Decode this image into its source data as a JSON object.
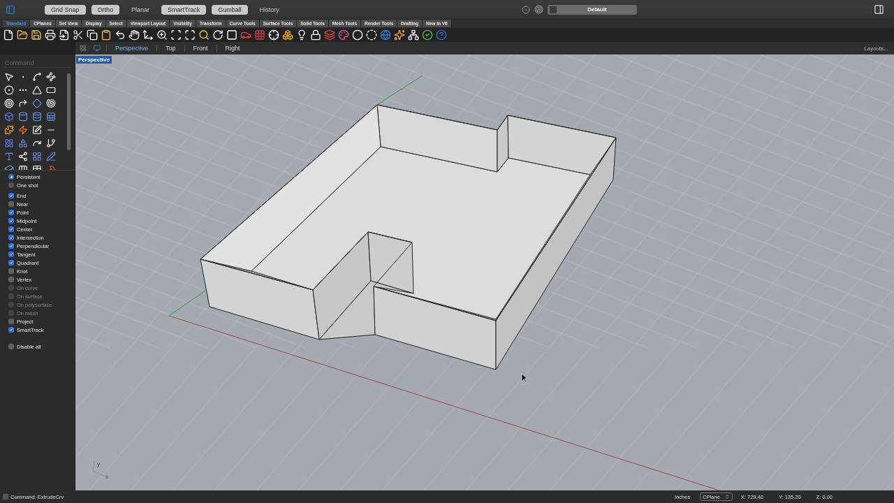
{
  "top_buttons": [
    {
      "label": "Grid Snap",
      "on": true
    },
    {
      "label": "Ortho",
      "on": true
    },
    {
      "label": "Planar",
      "on": false
    },
    {
      "label": "SmartTrack",
      "on": true
    },
    {
      "label": "Gumball",
      "on": true
    },
    {
      "label": "History",
      "on": false
    }
  ],
  "layer": {
    "name": "Default"
  },
  "toolbar_tabs": [
    {
      "label": "Standard",
      "selected": true
    },
    {
      "label": "CPlanes",
      "selected": false
    },
    {
      "label": "Set View",
      "selected": false
    },
    {
      "label": "Display",
      "selected": false
    },
    {
      "label": "Select",
      "selected": false
    },
    {
      "label": "Viewport Layout",
      "selected": false
    },
    {
      "label": "Visibility",
      "selected": false
    },
    {
      "label": "Transform",
      "selected": false
    },
    {
      "label": "Curve Tools",
      "selected": false
    },
    {
      "label": "Surface Tools",
      "selected": false
    },
    {
      "label": "Solid Tools",
      "selected": false
    },
    {
      "label": "Mesh Tools",
      "selected": false
    },
    {
      "label": "Render Tools",
      "selected": false
    },
    {
      "label": "Drafting",
      "selected": false
    },
    {
      "label": "New in V6",
      "selected": false
    }
  ],
  "command": {
    "placeholder": "Command"
  },
  "viewport_tabs": [
    {
      "label": "Perspective",
      "selected": true
    },
    {
      "label": "Top",
      "selected": false
    },
    {
      "label": "Front",
      "selected": false
    },
    {
      "label": "Right",
      "selected": false
    }
  ],
  "layouts": "Layouts...",
  "viewport": {
    "title": "Perspective",
    "gizmo_y": "y",
    "gizmo_x": "x"
  },
  "osnap_modes": [
    {
      "label": "Persistent",
      "selected": true
    },
    {
      "label": "One shot",
      "selected": false
    }
  ],
  "osnaps": [
    {
      "label": "End",
      "checked": true,
      "disabled": false
    },
    {
      "label": "Near",
      "checked": false,
      "disabled": false
    },
    {
      "label": "Point",
      "checked": true,
      "disabled": false
    },
    {
      "label": "Midpoint",
      "checked": true,
      "disabled": false
    },
    {
      "label": "Center",
      "checked": true,
      "disabled": false
    },
    {
      "label": "Intersection",
      "checked": true,
      "disabled": false
    },
    {
      "label": "Perpendicular",
      "checked": true,
      "disabled": false
    },
    {
      "label": "Tangent",
      "checked": true,
      "disabled": false
    },
    {
      "label": "Quadrant",
      "checked": true,
      "disabled": false
    },
    {
      "label": "Knot",
      "checked": false,
      "disabled": false
    },
    {
      "label": "Vertex",
      "checked": false,
      "disabled": false
    },
    {
      "label": "On curve",
      "checked": false,
      "disabled": true
    },
    {
      "label": "On surface",
      "checked": false,
      "disabled": true
    },
    {
      "label": "On polysurface",
      "checked": false,
      "disabled": true
    },
    {
      "label": "On mesh",
      "checked": false,
      "disabled": true
    },
    {
      "label": "Project",
      "checked": false,
      "disabled": false
    },
    {
      "label": "SmartTrack",
      "checked": true,
      "disabled": false
    }
  ],
  "disable_all": {
    "label": "Disable all",
    "checked": false
  },
  "status_bar": {
    "checked": false,
    "command": "Command: ExtrudeCrv",
    "units": "Inches",
    "cplane": "CPlane",
    "x": "X: 729.40",
    "y": "Y: 135.20",
    "z": "Z: 0.00"
  }
}
